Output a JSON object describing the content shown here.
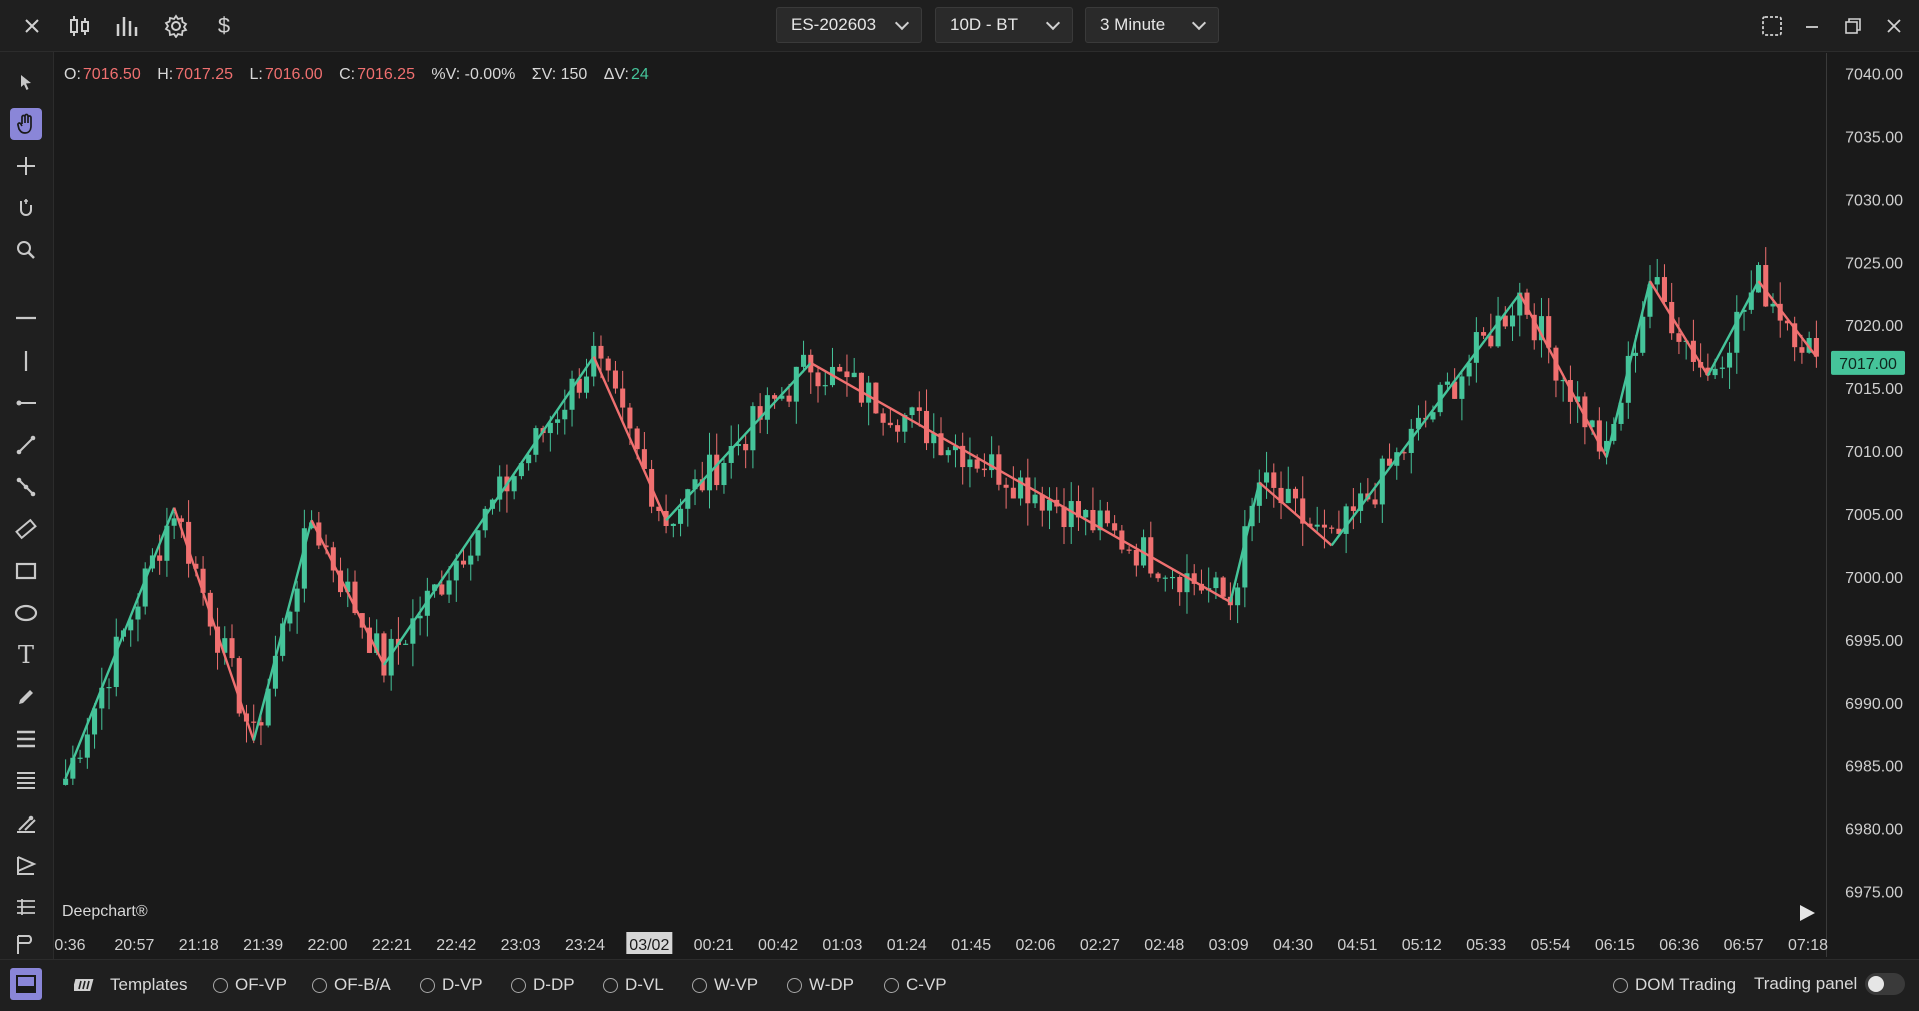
{
  "topbar": {
    "symbol": "ES-202603",
    "range": "10D - BT",
    "timeframe": "3 Minute",
    "icons": [
      "close-icon",
      "candlestick-icon",
      "bar-chart-icon",
      "settings-icon",
      "dollar-icon"
    ],
    "window_icons": [
      "layout-icon",
      "minimize-icon",
      "restore-icon",
      "close-icon"
    ]
  },
  "left_toolbar": {
    "tools": [
      "cursor-icon",
      "hand-icon",
      "crosshair-icon",
      "magnet-icon",
      "zoom-icon",
      "horizontal-line-icon",
      "vertical-line-icon",
      "ray-icon",
      "trend-line-icon",
      "path-icon",
      "ruler-icon",
      "rectangle-icon",
      "ellipse-icon",
      "text-icon",
      "pencil-icon",
      "fib-icon",
      "levels-icon",
      "pitchfork-icon",
      "forecast-icon",
      "layers-icon",
      "user-icon"
    ],
    "active_tool": "hand-icon"
  },
  "ohlc": {
    "o_label": "O:",
    "o": "7016.50",
    "h_label": "H:",
    "h": "7017.25",
    "l_label": "L:",
    "l": "7016.00",
    "c_label": "C:",
    "c": "7016.25",
    "pv": "%V: -0.00%",
    "sv": "ΣV: 150",
    "dv_label": "ΔV:",
    "dv": "24"
  },
  "watermark": "Deepchart®",
  "colors": {
    "up": "#45c49a",
    "down": "#f07070",
    "background": "#1a1a1a",
    "accent": "#8a86d8",
    "price_tag": "#45c49a"
  },
  "chart_data": {
    "type": "candlestick",
    "y_ticks": [
      "7040.00",
      "7035.00",
      "7030.00",
      "7025.00",
      "7020.00",
      "7015.00",
      "7010.00",
      "7005.00",
      "7000.00",
      "6995.00",
      "6990.00",
      "6985.00",
      "6980.00",
      "6975.00"
    ],
    "ylim": [
      6972.5,
      7042.5
    ],
    "x_ticks": [
      "0:36",
      "20:57",
      "21:18",
      "21:39",
      "22:00",
      "22:21",
      "22:42",
      "23:03",
      "23:24",
      "03/02",
      "00:21",
      "00:42",
      "01:03",
      "01:24",
      "01:45",
      "02:06",
      "02:27",
      "02:48",
      "03:09",
      "04:30",
      "04:51",
      "05:12",
      "05:33",
      "05:54",
      "06:15",
      "06:36",
      "06:57",
      "07:18"
    ],
    "highlighted_x_tick": "03/02",
    "current_price": "7017.00",
    "zigzag": [
      6984.0,
      7005.5,
      6987.0,
      7004.5,
      6993.0,
      7017.5,
      7004.5,
      7017.0,
      6998.0,
      7007.5,
      7002.5,
      7022.5,
      7009.5,
      7023.5,
      7016.0,
      7023.5,
      7017.5
    ],
    "zigzag_bars": [
      0,
      15,
      26,
      34,
      44,
      73,
      83,
      103,
      161,
      165,
      175,
      201,
      213,
      219,
      227,
      234,
      242
    ]
  },
  "bottombar": {
    "templates_label": "Templates",
    "items": [
      "OF-VP",
      "OF-B/A",
      "D-VP",
      "D-DP",
      "D-VL",
      "W-VP",
      "W-DP",
      "C-VP"
    ],
    "dom_trading": "DOM Trading",
    "trading_panel": "Trading panel"
  }
}
